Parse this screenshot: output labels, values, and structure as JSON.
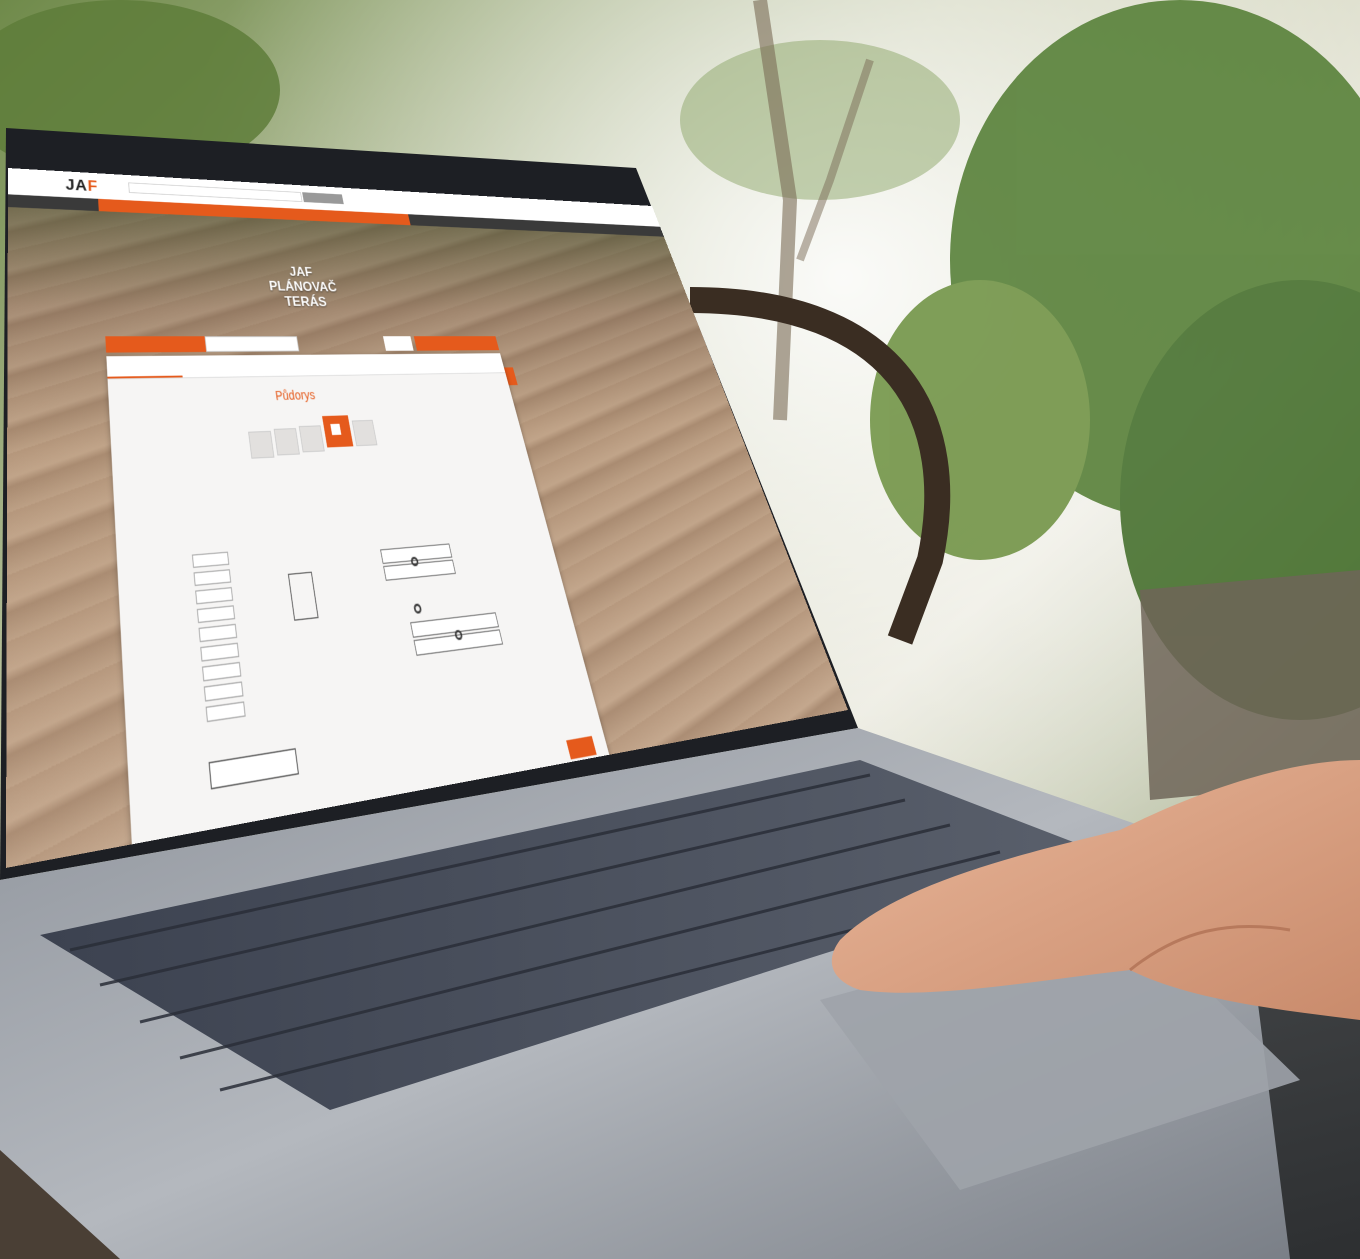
{
  "scene": {
    "description_colors": {
      "accent": "#e55a1c",
      "dark": "#3a3a3a"
    }
  },
  "site": {
    "logo": {
      "main": "JA",
      "accent": "F"
    },
    "hero_title": [
      "JAF",
      "PLÁNOVAČ",
      "TERÁS"
    ]
  },
  "planner": {
    "step_title": "Půdorys"
  }
}
